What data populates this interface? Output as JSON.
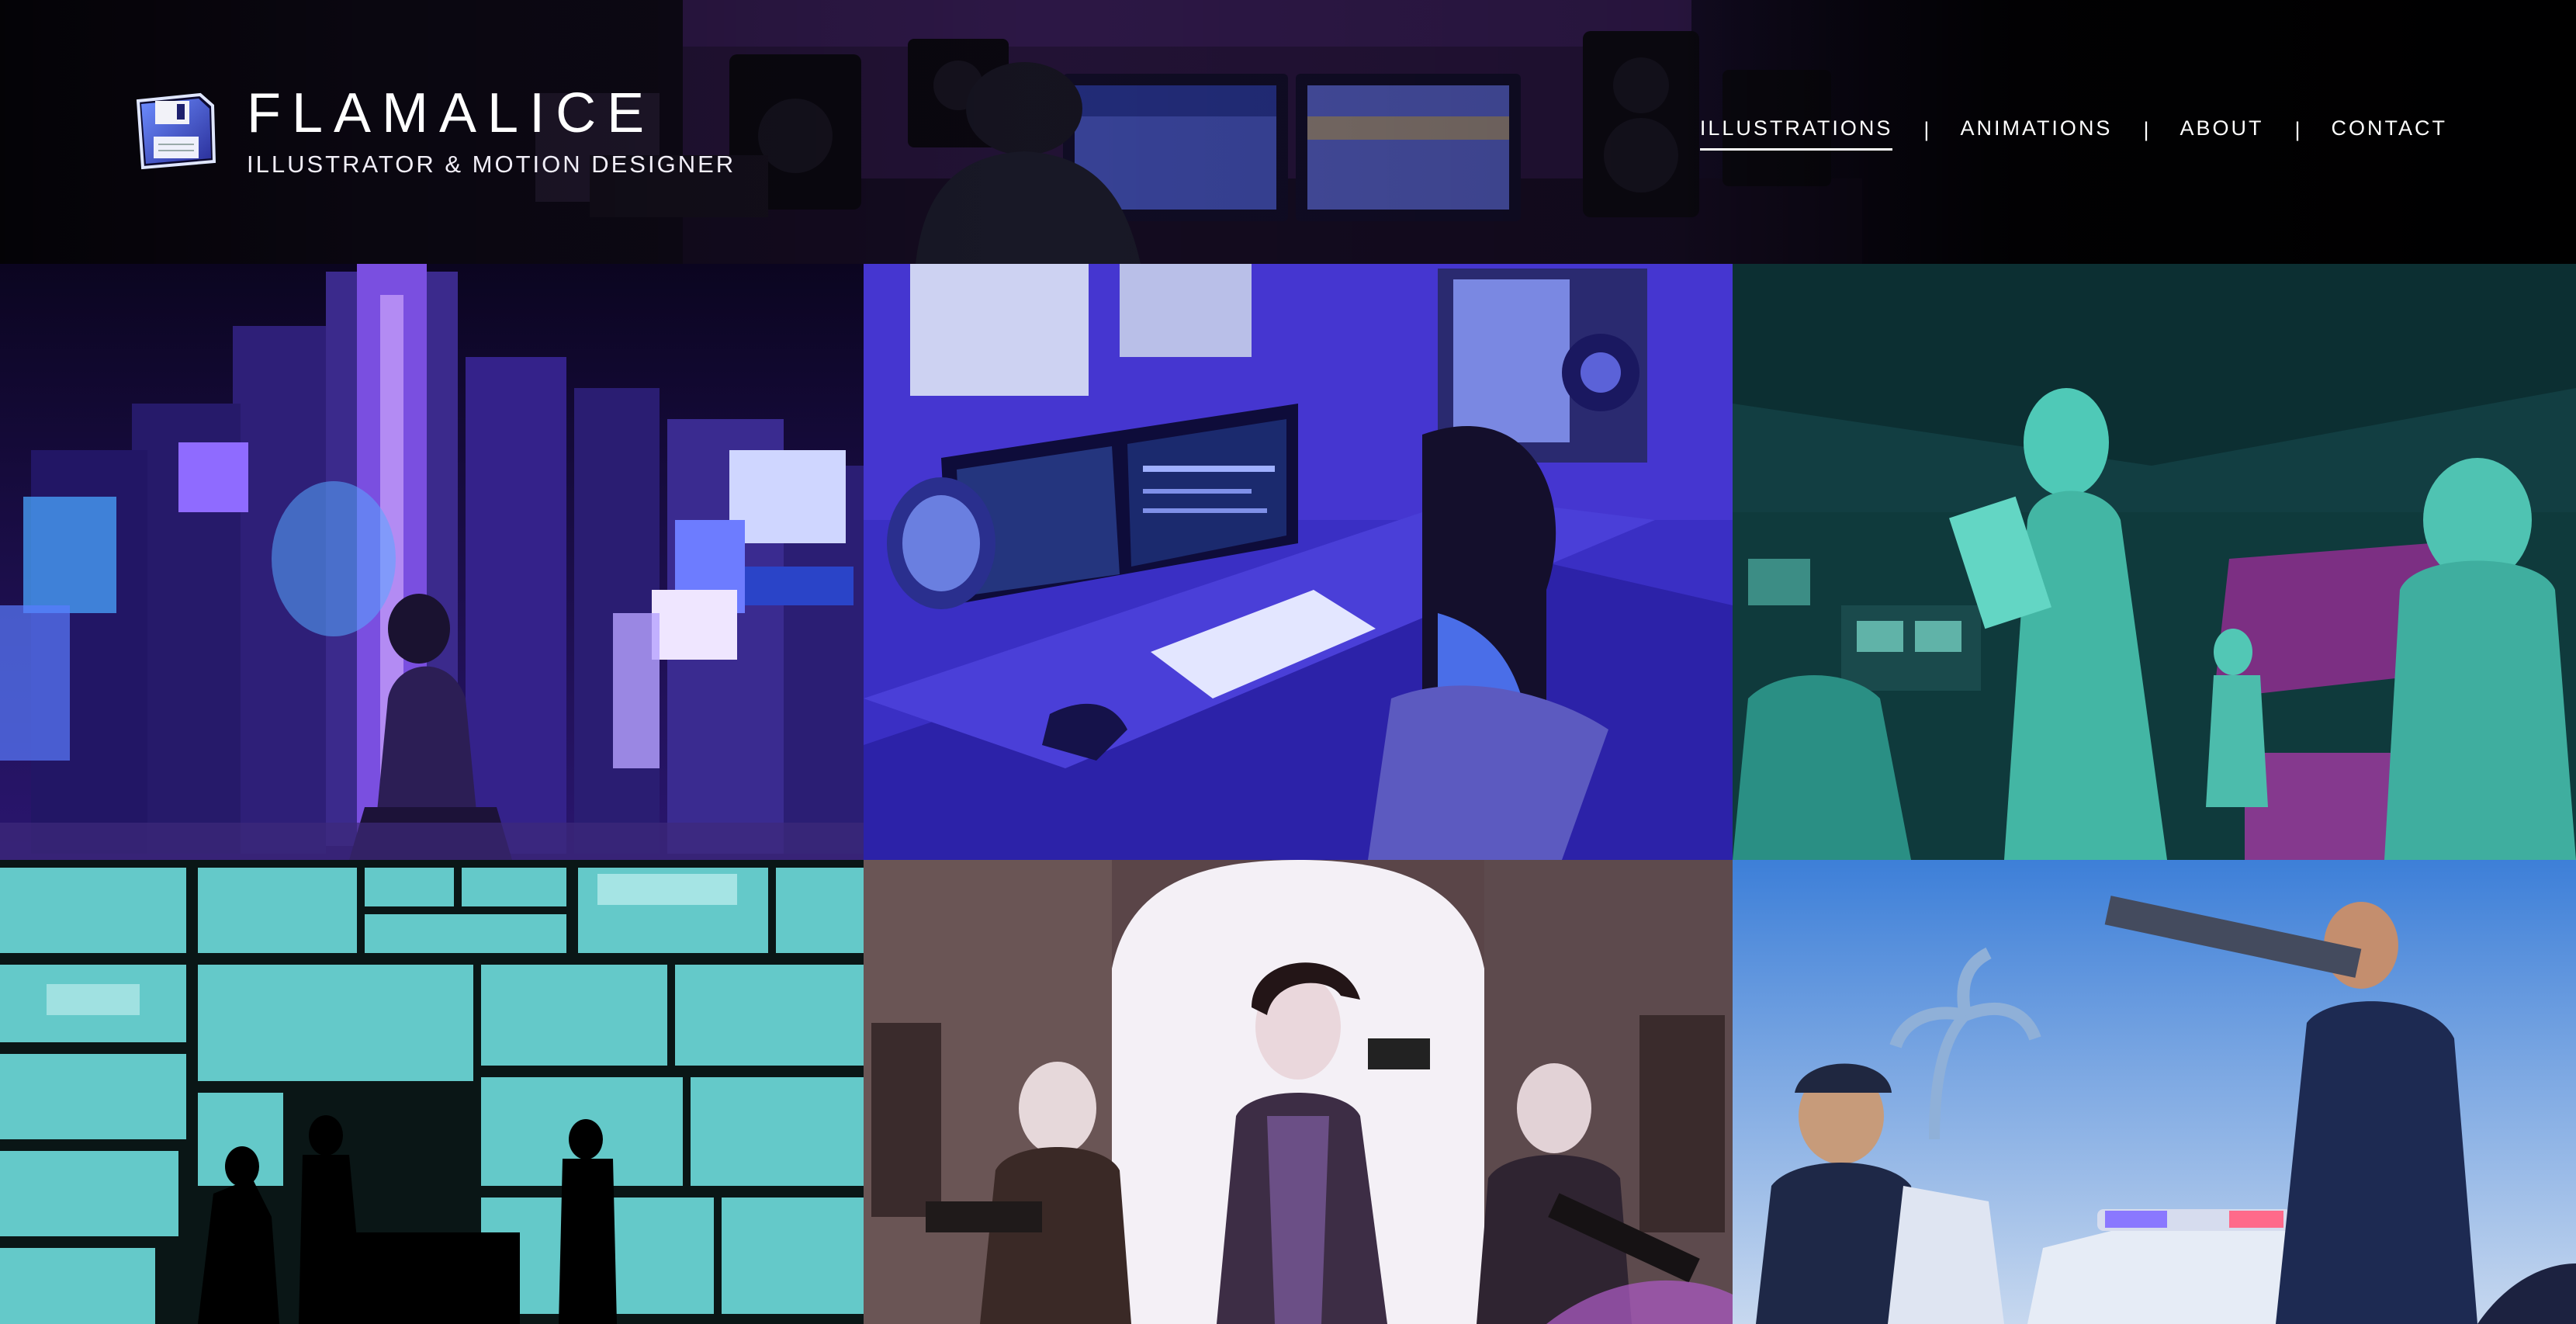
{
  "brand": {
    "name": "FLAMALICE",
    "tagline": "ILLUSTRATOR & MOTION DESIGNER",
    "logo_icon": "floppy-disk-icon"
  },
  "nav": {
    "items": [
      {
        "label": "ILLUSTRATIONS",
        "active": true
      },
      {
        "label": "ANIMATIONS",
        "active": false
      },
      {
        "label": "ABOUT",
        "active": false
      },
      {
        "label": "CONTACT",
        "active": false
      }
    ],
    "separator": "|"
  },
  "gallery": {
    "tiles": [
      {
        "subject": "neon-city-illustration",
        "palette": "#5a2fd1"
      },
      {
        "subject": "streamer-desk-illustration",
        "palette": "#3e2fc9"
      },
      {
        "subject": "teal-control-room-illustration",
        "palette": "#3fbfb0"
      },
      {
        "subject": "surveillance-screens-illustration",
        "palette": "#5fc9c9"
      },
      {
        "subject": "masked-crew-illustration",
        "palette": "#7a4f8a"
      },
      {
        "subject": "police-standoff-illustration",
        "palette": "#3f6fc9"
      }
    ]
  },
  "colors": {
    "header_bg": "#050409",
    "text": "#ffffff",
    "neon_purple": "#8a5cff",
    "teal": "#3fbfb0"
  }
}
